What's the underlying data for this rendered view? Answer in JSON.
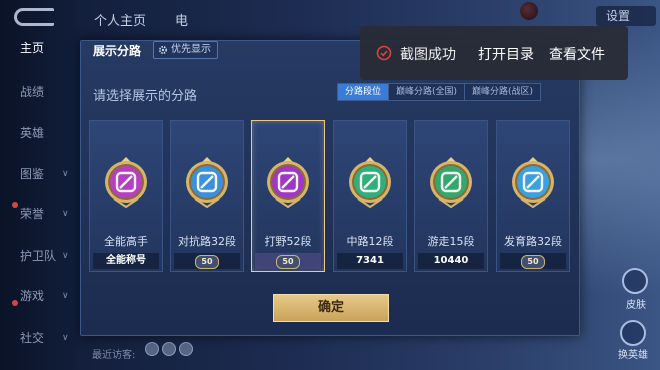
{
  "background": {
    "top_tabs": [
      "个人主页",
      "电"
    ],
    "settings_label": "设置",
    "nav_items": [
      {
        "label": "主页",
        "chevron": false,
        "active": true
      },
      {
        "label": "战绩",
        "chevron": false,
        "active": false
      },
      {
        "label": "英雄",
        "chevron": false,
        "active": false
      },
      {
        "label": "图鉴",
        "chevron": true,
        "active": false
      },
      {
        "label": "荣誉",
        "chevron": true,
        "active": false
      },
      {
        "label": "护卫队",
        "chevron": true,
        "active": false
      },
      {
        "label": "游戏",
        "chevron": true,
        "active": false
      },
      {
        "label": "社交",
        "chevron": true,
        "active": false
      }
    ],
    "right_labels": [
      "皮肤",
      "换英雄"
    ],
    "bottom_text": "最近访客:"
  },
  "dialog": {
    "title": "展示分路",
    "priority_label": "优先显示",
    "subtitle": "请选择展示的分路",
    "tabs": [
      {
        "label": "分路段位",
        "active": true
      },
      {
        "label": "巅峰分路(全国)",
        "active": false
      },
      {
        "label": "巅峰分路(战区)",
        "active": false
      }
    ],
    "cards": [
      {
        "name": "全能高手",
        "footer": "全能称号",
        "badge": "",
        "medal_color": "#b53fc0",
        "medal_symbol": "all-round",
        "selected": false
      },
      {
        "name": "对抗路32段",
        "footer": "",
        "badge": "50",
        "medal_color": "#3c8fd9",
        "medal_symbol": "clash-lane",
        "selected": false
      },
      {
        "name": "打野52段",
        "footer": "",
        "badge": "50",
        "medal_color": "#a036c6",
        "medal_symbol": "jungle",
        "selected": true
      },
      {
        "name": "中路12段",
        "footer": "7341",
        "badge": "",
        "medal_color": "#2fb07a",
        "medal_symbol": "mid-lane",
        "selected": false
      },
      {
        "name": "游走15段",
        "footer": "10440",
        "badge": "",
        "medal_color": "#34a86c",
        "medal_symbol": "roam",
        "selected": false
      },
      {
        "name": "发育路32段",
        "footer": "",
        "badge": "50",
        "medal_color": "#3aa0e0",
        "medal_symbol": "farm-lane",
        "selected": false
      }
    ],
    "confirm_label": "确定"
  },
  "toast": {
    "message": "截图成功",
    "open_dir_label": "打开目录",
    "view_file_label": "查看文件",
    "icon": "check-circle-icon",
    "icon_color": "#e0403a"
  }
}
